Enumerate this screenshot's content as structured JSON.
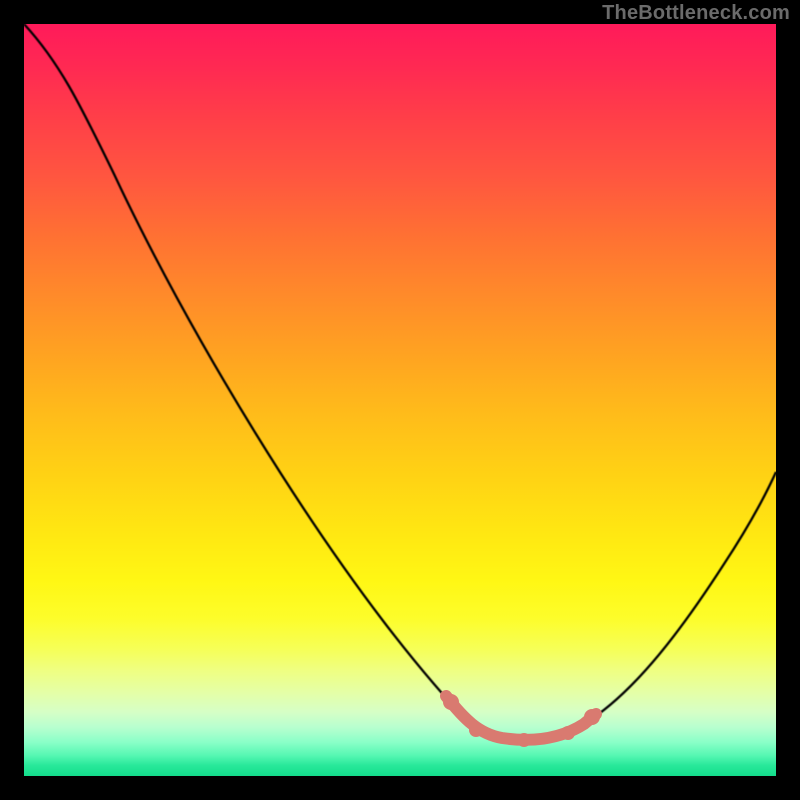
{
  "watermark": "TheBottleneck.com",
  "chart_data": {
    "type": "line",
    "title": "",
    "xlabel": "",
    "ylabel": "",
    "xlim": [
      0,
      100
    ],
    "ylim": [
      0,
      100
    ],
    "grid": false,
    "legend": false,
    "series": [
      {
        "name": "curve",
        "color": "#000000",
        "x": [
          0,
          6,
          12,
          18,
          24,
          30,
          36,
          42,
          48,
          54,
          58,
          62,
          64,
          66,
          68,
          70,
          72,
          74,
          78,
          82,
          86,
          90,
          94,
          98,
          100
        ],
        "y": [
          100,
          95,
          88,
          80,
          72,
          63,
          54,
          45,
          36,
          26,
          18,
          11,
          8,
          6,
          5.2,
          5,
          5.2,
          5.8,
          8,
          13,
          21,
          31,
          42,
          53,
          58
        ]
      },
      {
        "name": "bottleneck-highlight",
        "color": "#d97a70",
        "x": [
          58,
          60.5,
          63,
          65,
          67,
          69,
          71,
          73,
          74.5,
          76
        ],
        "y": [
          10,
          7.8,
          6.2,
          5.4,
          5.0,
          5.0,
          5.2,
          6.0,
          7.2,
          9.0
        ]
      }
    ],
    "background_gradient": {
      "top": "#ff1a5a",
      "mid": "#ffe812",
      "bottom": "#13dd8c"
    }
  }
}
